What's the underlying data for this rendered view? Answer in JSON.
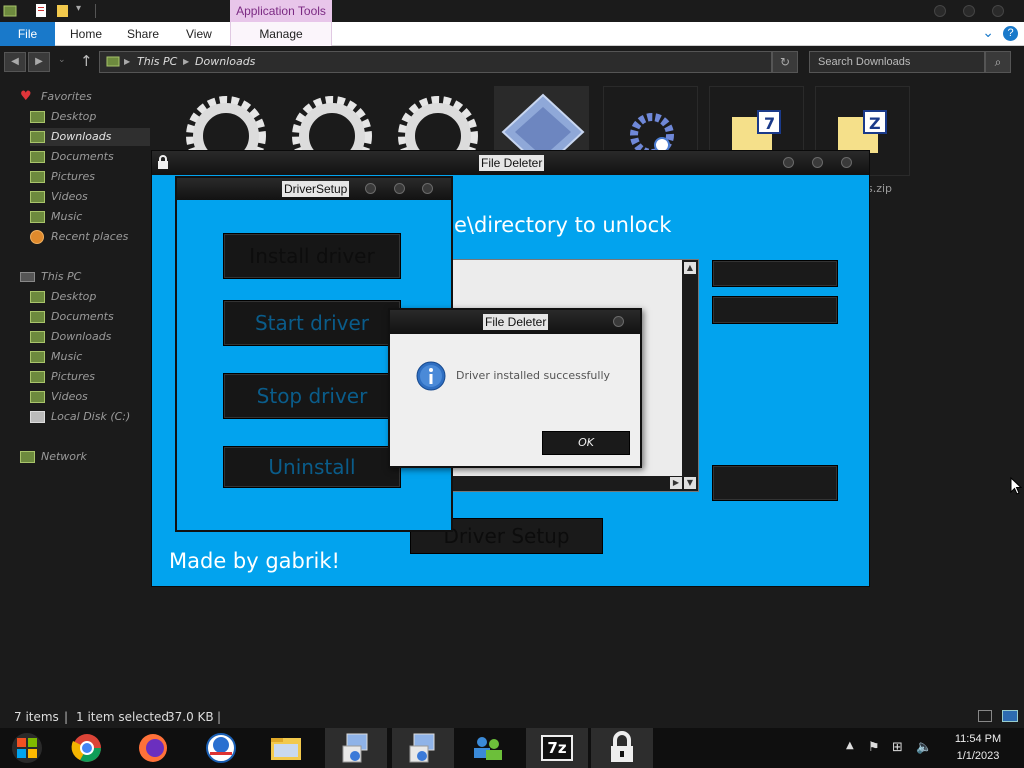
{
  "explorer": {
    "ribbon": {
      "contextual_group": "Application Tools",
      "tabs": [
        "File",
        "Home",
        "Share",
        "View",
        "Manage"
      ],
      "help": "?"
    },
    "address": {
      "crumbs": [
        "This PC",
        "Downloads"
      ]
    },
    "search": {
      "placeholder": "Search Downloads"
    },
    "nav": {
      "favorites_header": "Favorites",
      "favorites": [
        "Desktop",
        "Downloads",
        "Documents",
        "Pictures",
        "Videos",
        "Music",
        "Recent places"
      ],
      "thispc_header": "This PC",
      "thispc": [
        "Desktop",
        "Documents",
        "Downloads",
        "Music",
        "Pictures",
        "Videos",
        "Local Disk (C:)"
      ],
      "network": "Network"
    },
    "files": {
      "partial_filename": "gs.zip"
    },
    "status": {
      "items": "7 items",
      "selected": "1 item selected",
      "size": "37.0 KB"
    }
  },
  "file_deleter": {
    "title": "File Deleter",
    "heading": "he file\\directory to unlock",
    "driver_setup_button": "Driver Setup",
    "credit": "Made by gabrik!"
  },
  "driver_setup": {
    "title": "DriverSetup",
    "install": "Install driver",
    "start": "Start driver",
    "stop": "Stop driver",
    "uninstall": "Uninstall"
  },
  "message_box": {
    "title": "File Deleter",
    "message": "Driver installed successfully",
    "ok": "OK"
  },
  "taskbar": {
    "clock_time": "11:54 PM",
    "clock_date": "1/1/2023",
    "zip_label": "7z"
  },
  "colors": {
    "app_blue": "#02a3ee",
    "file_tab": "#1979ca",
    "context_tab": "#e8c6ea"
  }
}
